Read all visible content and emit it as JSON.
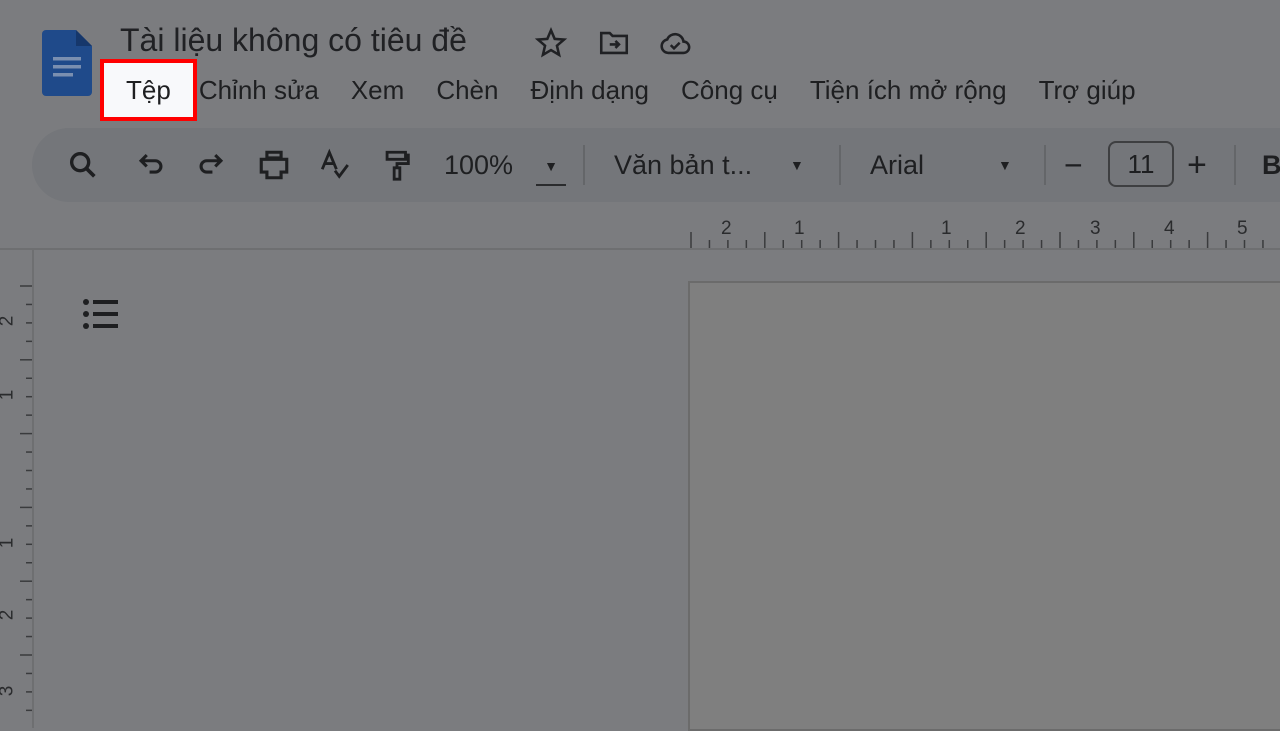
{
  "header": {
    "title": "Tài liệu không có tiêu đề",
    "icons": [
      "docs-logo",
      "star-icon",
      "move-folder-icon",
      "cloud-saved-icon"
    ]
  },
  "menu": {
    "items": [
      "Tệp",
      "Chỉnh sửa",
      "Xem",
      "Chèn",
      "Định dạng",
      "Công cụ",
      "Tiện ích mở rộng",
      "Trợ giúp"
    ],
    "highlighted": "Tệp",
    "highlight_color": "#ff0000"
  },
  "toolbar": {
    "zoom": "100%",
    "style": "Văn bản t...",
    "font": "Arial",
    "font_size": "11",
    "bold": "B",
    "minus": "−",
    "plus": "+"
  },
  "ruler": {
    "horizontal": [
      "2",
      "1",
      "1",
      "2",
      "3",
      "4",
      "5"
    ],
    "vertical": [
      "2",
      "1",
      "1",
      "2",
      "3"
    ]
  }
}
